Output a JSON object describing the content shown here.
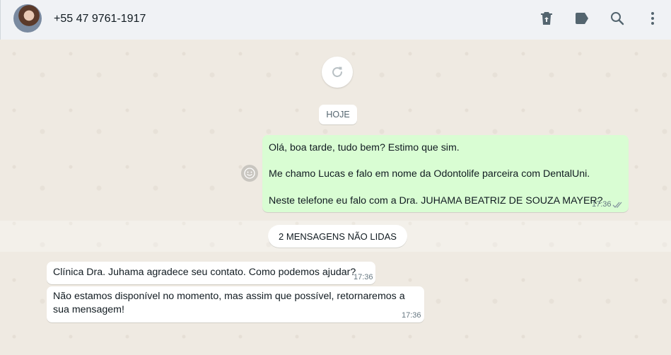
{
  "header": {
    "contact_name": "+55 47 9761-1917",
    "icons": [
      "delete-icon",
      "label-icon",
      "search-icon",
      "menu-icon"
    ]
  },
  "chat": {
    "date_divider": "HOJE",
    "outgoing": {
      "lines": [
        "Olá, boa tarde, tudo bem? Estimo que sim.",
        "Me chamo Lucas e falo em nome da Odontolife parceira com DentalUni.",
        "Neste telefone eu falo com a Dra. JUHAMA BEATRIZ DE SOUZA MAYER?"
      ],
      "time": "17:36",
      "status": "delivered-double-check"
    },
    "unread_divider": "2 MENSAGENS NÃO LIDAS",
    "incoming": [
      {
        "text": "Clínica Dra. Juhama agradece seu contato. Como podemos ajudar?",
        "time": "17:36"
      },
      {
        "text": "Não estamos disponível no momento, mas assim que possível, retornaremos a sua mensagem!",
        "time": "17:36"
      }
    ]
  },
  "colors": {
    "outgoing_bubble": "#d9fdd3",
    "incoming_bubble": "#ffffff",
    "chat_background": "#efeae2",
    "header_background": "#f0f2f5"
  }
}
